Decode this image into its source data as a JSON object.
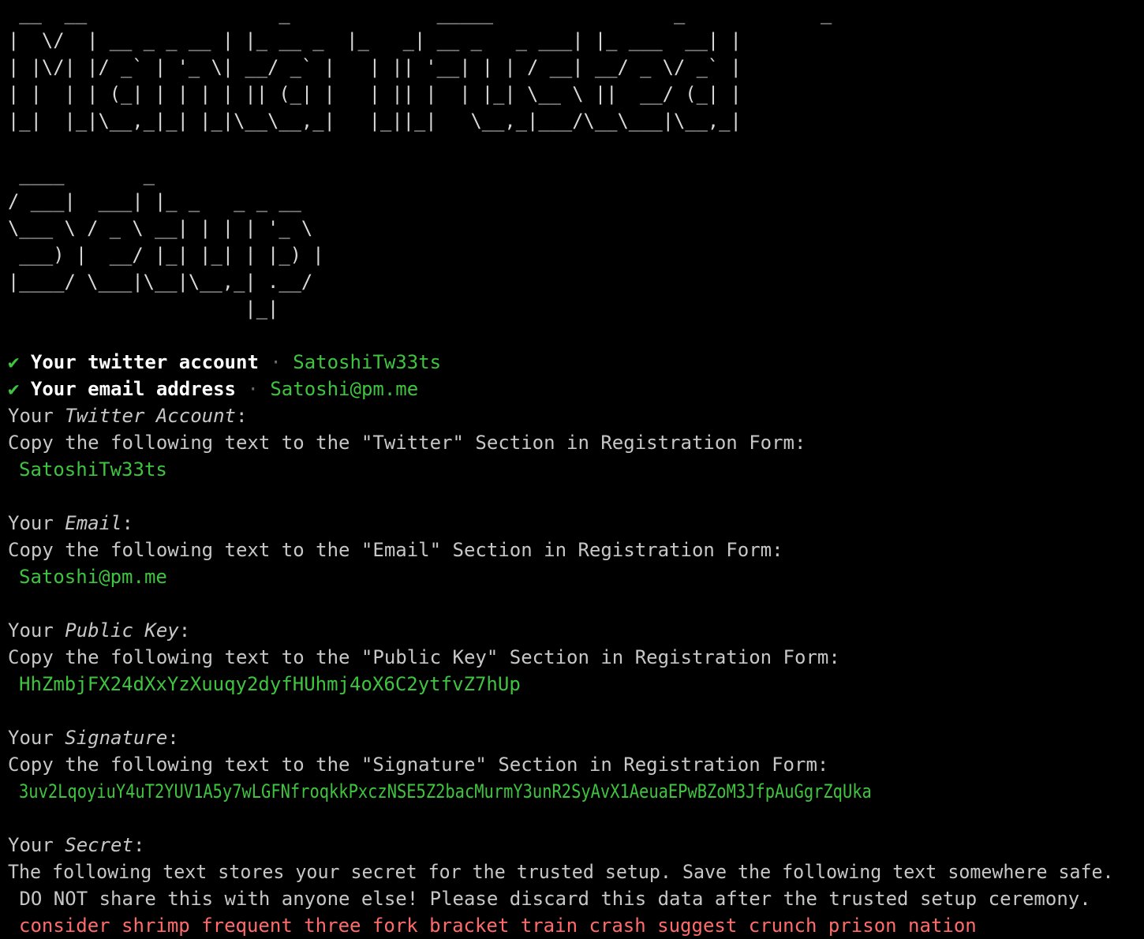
{
  "banner": {
    "title_art": [
      " __  __                 _             _____                _            _ ",
      "|  \\/  | __ _ _ __ | |_ __ _  |_   _| __ _   _ ___| |_ ___  __| |",
      "| |\\/| |/ _` | '_ \\| __/ _` |   | || '__| | | / __| __/ _ \\/ _` |",
      "| |  | | (_| | | | | || (_| |   | || |  | |_| \\__ \\ ||  __/ (_| |",
      "|_|  |_|\\__,_|_| |_|\\__\\__,_|   |_||_|   \\__,_|___/\\__\\___|\\__,_|"
    ],
    "setup_art": [
      " ____       _ ",
      "/ ___|  ___| |_ _   _ _ __ ",
      "\\___ \\ / _ \\ __| | | | '_ \\ ",
      " ___) |  __/ |_| |_| | |_) |",
      "|____/ \\___|\\__|\\__,_| .__/ ",
      "                     |_|"
    ]
  },
  "confirmations": [
    {
      "check": "✔",
      "label": "Your twitter account",
      "sep": "·",
      "value": "SatoshiTw33ts"
    },
    {
      "check": "✔",
      "label": "Your email address",
      "sep": "·",
      "value": "Satoshi@pm.me"
    }
  ],
  "sections": {
    "twitter": {
      "prefix": "Your ",
      "name": "Twitter Account",
      "suffix": ":",
      "instruction": "Copy the following text to the \"Twitter\" Section in Registration Form:",
      "value": "SatoshiTw33ts"
    },
    "email": {
      "prefix": "Your ",
      "name": "Email",
      "suffix": ":",
      "instruction": "Copy the following text to the \"Email\" Section in Registration Form:",
      "value": "Satoshi@pm.me"
    },
    "public_key": {
      "prefix": "Your ",
      "name": "Public Key",
      "suffix": ":",
      "instruction": "Copy the following text to the \"Public Key\" Section in Registration Form:",
      "value": "HhZmbjFX24dXxYzXuuqy2dyfHUhmj4oX6C2ytfvZ7hUp"
    },
    "signature": {
      "prefix": "Your ",
      "name": "Signature",
      "suffix": ":",
      "instruction": "Copy the following text to the \"Signature\" Section in Registration Form:",
      "value": "3uv2LqoyiuY4uT2YUV1A5y7wLGFNfroqkkPxczNSE5Z2bacMurmY3unR2SyAvX1AeuaEPwBZoM3JfpAuGgrZqUka"
    },
    "secret": {
      "prefix": "Your ",
      "name": "Secret",
      "suffix": ":",
      "instruction_1": "The following text stores your secret for the trusted setup. Save the following text somewhere safe.",
      "instruction_2": " DO NOT share this with anyone else! Please discard this data after the trusted setup ceremony.",
      "value": "consider shrimp frequent three fork bracket train crash suggest crunch prison nation"
    }
  },
  "colors": {
    "background": "#000000",
    "text": "#c7c7c7",
    "success_green": "#3fc43f",
    "secret_red": "#ff6b6b"
  }
}
